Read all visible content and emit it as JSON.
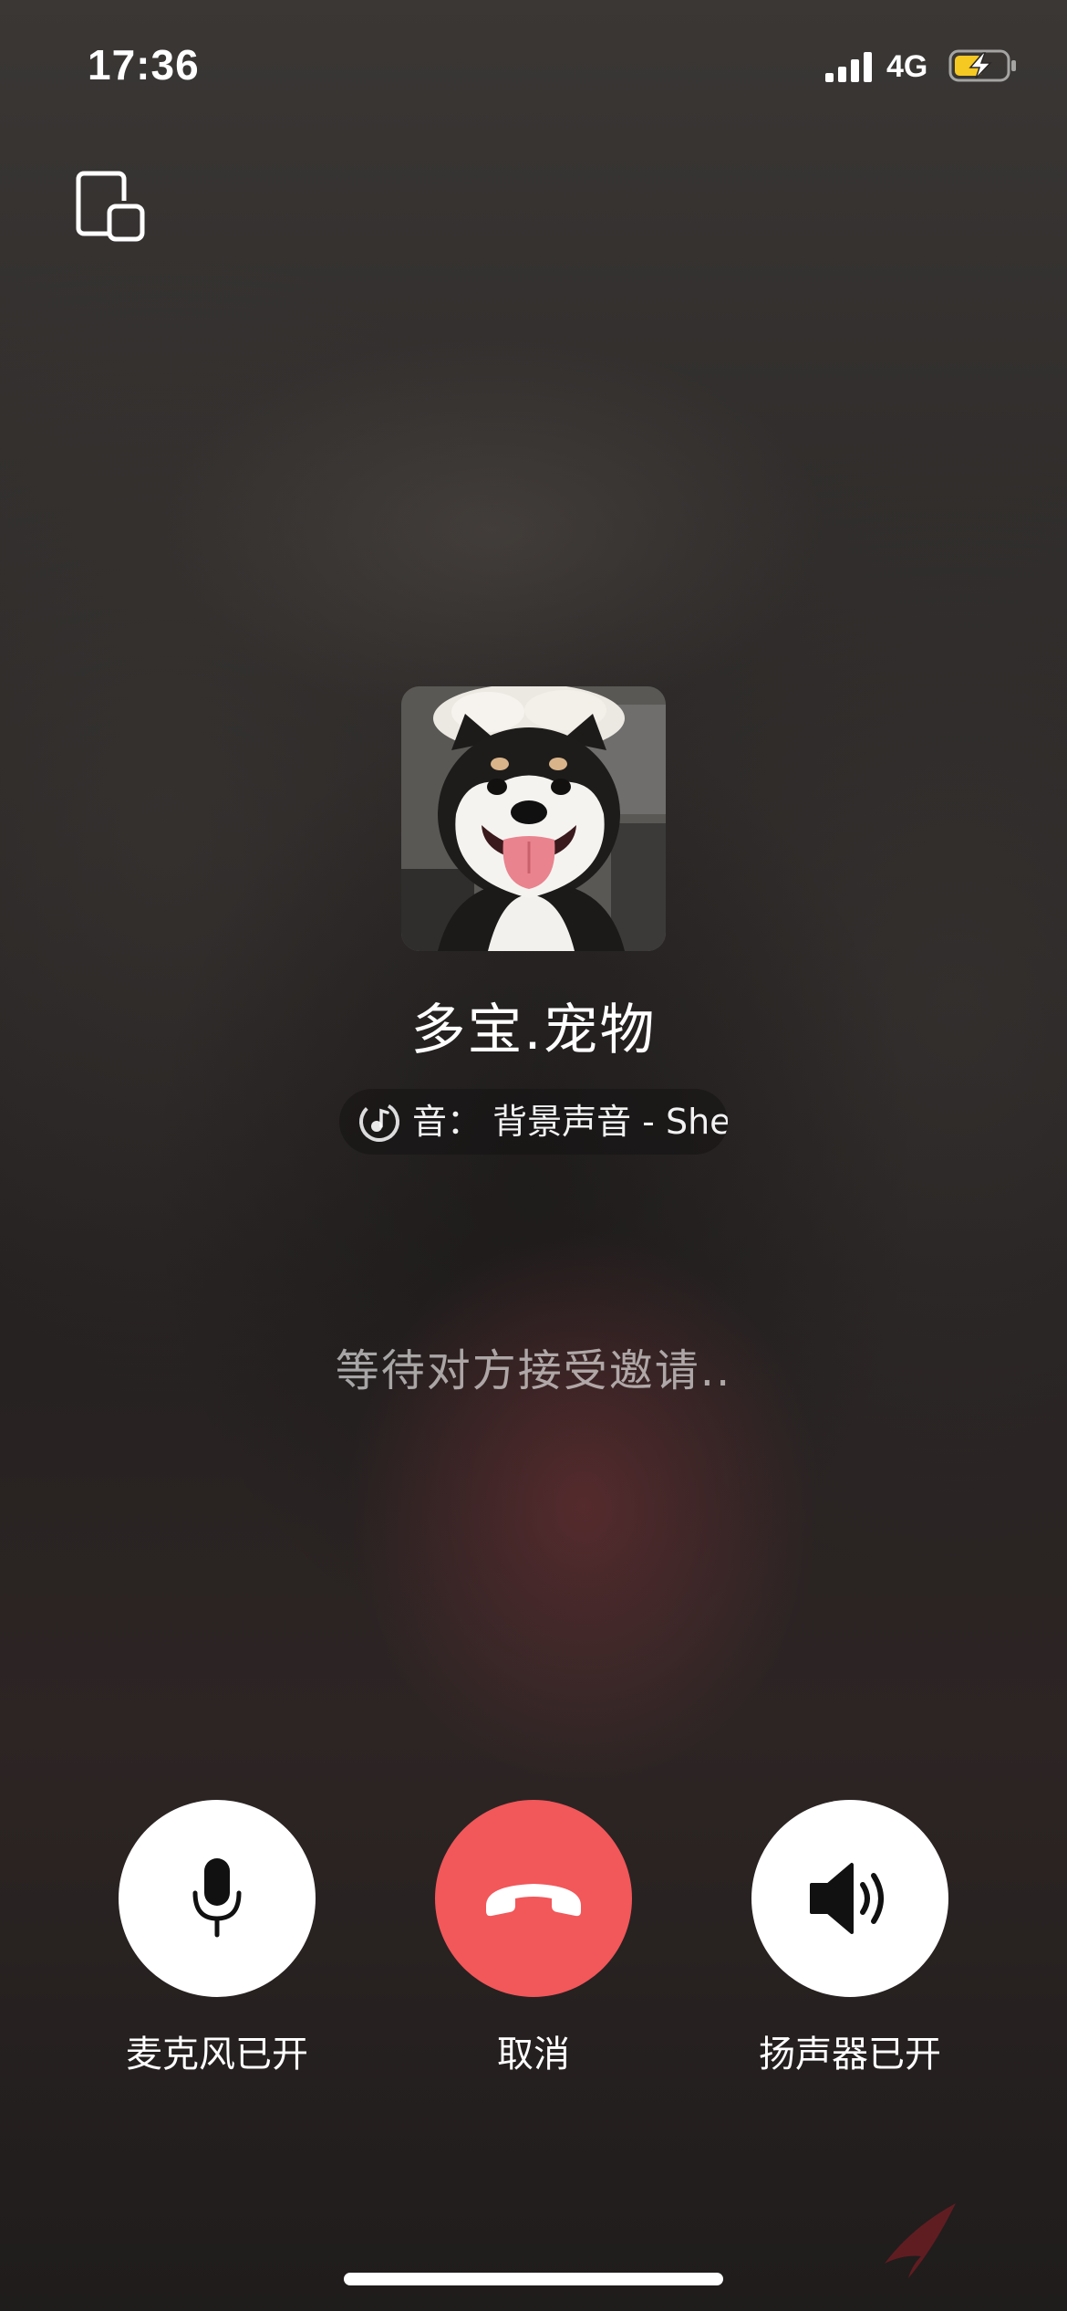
{
  "status_bar": {
    "time": "17:36",
    "network": "4G",
    "signal_icon": "cellular-signal-icon",
    "battery_icon": "battery-charging-icon",
    "battery_color": "#f6c822"
  },
  "top_left_icon": "floating-window-icon",
  "contact": {
    "name": "多宝.宠物",
    "avatar_icon": "avatar-photo-dog"
  },
  "music": {
    "icon": "music-note-icon",
    "text": "音：  背景声音 - She"
  },
  "status_text": "等待对方接受邀请..",
  "controls": {
    "mic": {
      "label": "麦克风已开",
      "icon": "microphone-icon"
    },
    "cancel": {
      "label": "取消",
      "icon": "hang-up-icon",
      "color": "#f2575a"
    },
    "speaker": {
      "label": "扬声器已开",
      "icon": "speaker-icon"
    }
  }
}
